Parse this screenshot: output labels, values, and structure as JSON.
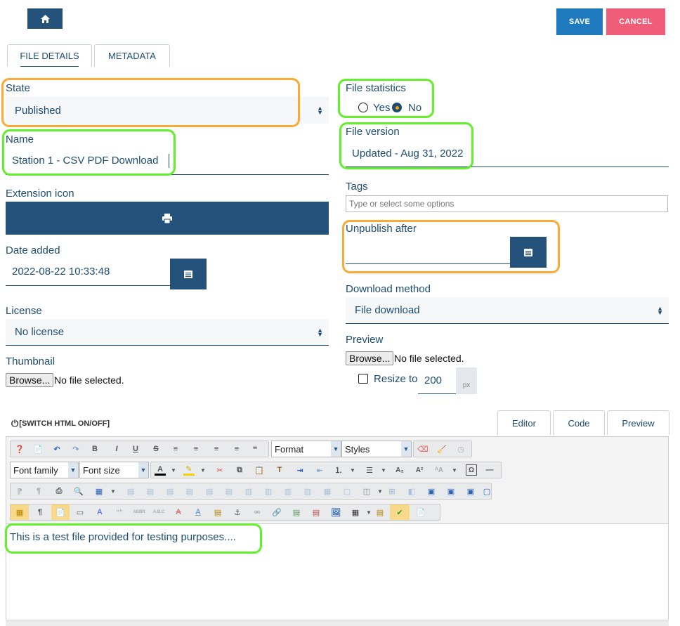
{
  "header": {
    "home_icon": "home-icon",
    "save_label": "SAVE",
    "cancel_label": "CANCEL",
    "colors": {
      "navy": "#25527a",
      "save": "#1f79bd",
      "cancel": "#ef5d78",
      "highlight_green": "#63f02c",
      "highlight_orange": "#fbaa35"
    }
  },
  "tabs": [
    {
      "label": "FILE DETAILS",
      "active": true
    },
    {
      "label": "METADATA",
      "active": false
    }
  ],
  "left": {
    "state": {
      "label": "State",
      "value": "Published"
    },
    "name": {
      "label": "Name",
      "value": "Station 1 - CSV PDF Download"
    },
    "extension_icon": {
      "label": "Extension icon",
      "icon": "pdf-icon"
    },
    "date_added": {
      "label": "Date added",
      "value": "2022-08-22 10:33:48",
      "icon": "calendar-icon"
    },
    "license": {
      "label": "License",
      "value": "No license"
    },
    "thumbnail": {
      "label": "Thumbnail",
      "browse": "Browse...",
      "status": "No file selected."
    }
  },
  "right": {
    "file_statistics": {
      "label": "File statistics",
      "yes": "Yes",
      "no": "No",
      "selected": "No"
    },
    "file_version": {
      "label": "File version",
      "value": "Updated - Aug 31, 2022"
    },
    "tags": {
      "label": "Tags",
      "placeholder": "Type or select some options"
    },
    "unpublish_after": {
      "label": "Unpublish after",
      "value": "",
      "icon": "calendar-icon"
    },
    "download_method": {
      "label": "Download method",
      "value": "File download"
    },
    "preview": {
      "label": "Preview",
      "browse": "Browse...",
      "status": "No file selected.",
      "resize_label": "Resize to",
      "resize_value": "200",
      "unit": "px",
      "resize_checked": false
    }
  },
  "editor": {
    "switch_label": "[SWITCH HTML ON/OFF]",
    "tabs": [
      "Editor",
      "Code",
      "Preview"
    ],
    "active_tab": "Editor",
    "format_label": "Format",
    "styles_label": "Styles",
    "font_family_label": "Font family",
    "font_size_label": "Font size",
    "content": "This is a test file provided for testing purposes...."
  }
}
